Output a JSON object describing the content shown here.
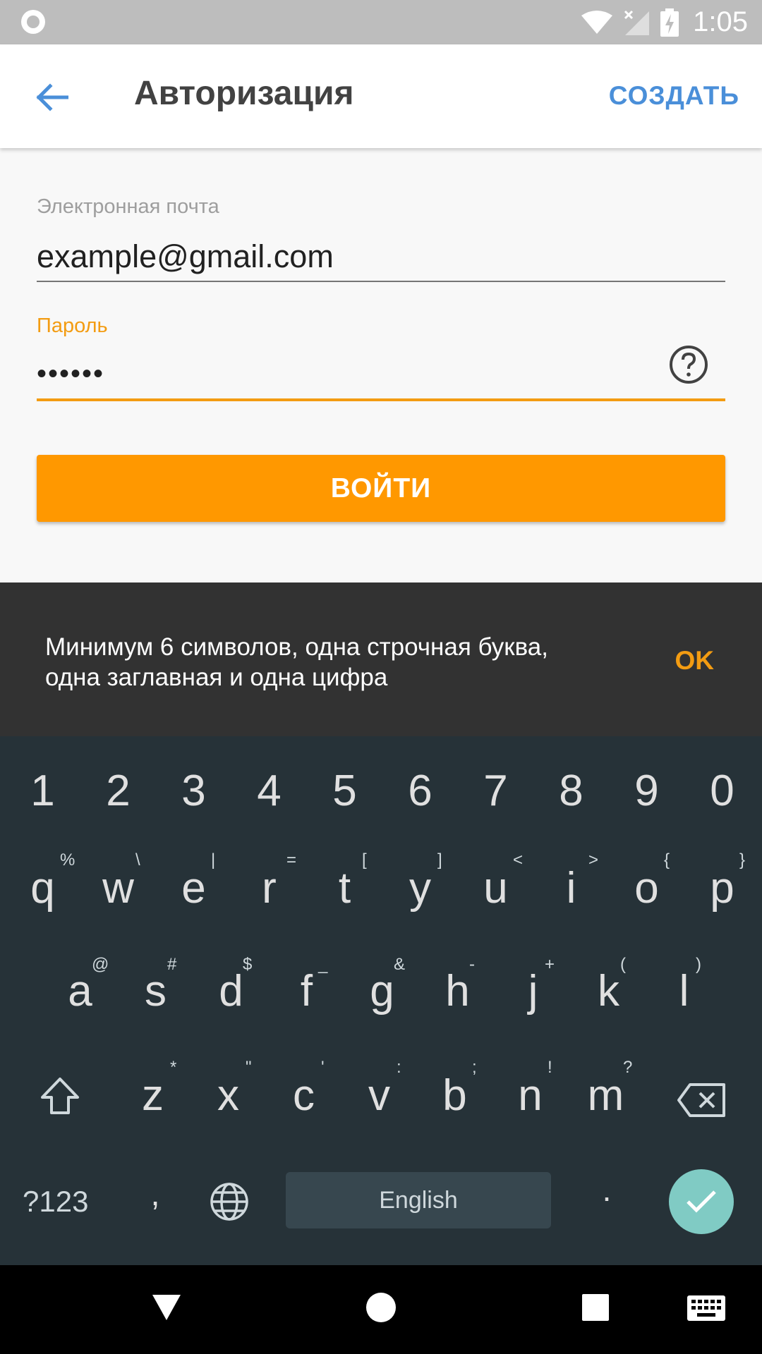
{
  "status_bar": {
    "time": "1:05"
  },
  "app_bar": {
    "title": "Авторизация",
    "create_label": "СОЗДАТЬ"
  },
  "form": {
    "email_label": "Электронная почта",
    "email_value": "example@gmail.com",
    "password_label": "Пароль",
    "password_value": "••••••",
    "login_label": "ВОЙТИ"
  },
  "snackbar": {
    "line1": "Минимум 6 символов, одна строчная буква,",
    "line2": "одна заглавная и одна цифра",
    "ok_label": "OK"
  },
  "keyboard": {
    "numbers": [
      "1",
      "2",
      "3",
      "4",
      "5",
      "6",
      "7",
      "8",
      "9",
      "0"
    ],
    "row1": [
      "q",
      "w",
      "e",
      "r",
      "t",
      "y",
      "u",
      "i",
      "o",
      "p"
    ],
    "row1_hints": [
      "%",
      "\\",
      "|",
      "=",
      "[",
      "]",
      "<",
      ">",
      "{",
      "}"
    ],
    "row2": [
      "a",
      "s",
      "d",
      "f",
      "g",
      "h",
      "j",
      "k",
      "l"
    ],
    "row2_hints": [
      "@",
      "#",
      "$",
      "_",
      "&",
      "-",
      "+",
      "(",
      ")"
    ],
    "row3": [
      "z",
      "x",
      "c",
      "v",
      "b",
      "n",
      "m"
    ],
    "row3_hints": [
      "*",
      "\"",
      "'",
      ":",
      ";",
      "!",
      "?"
    ],
    "symbols_label": "?123",
    "comma": ",",
    "period": ".",
    "space_label": "English"
  },
  "colors": {
    "accent": "#ff9800",
    "link": "#4a8fd9",
    "keyboard_bg": "#263238",
    "snackbar_bg": "#323232",
    "enter_key": "#80cbc4"
  },
  "icons": [
    "back-arrow-icon",
    "help-icon",
    "shift-icon",
    "backspace-icon",
    "globe-icon",
    "check-icon",
    "wifi-icon",
    "signal-icon",
    "battery-icon",
    "nav-back-icon",
    "nav-home-icon",
    "nav-recents-icon",
    "keyboard-icon"
  ]
}
